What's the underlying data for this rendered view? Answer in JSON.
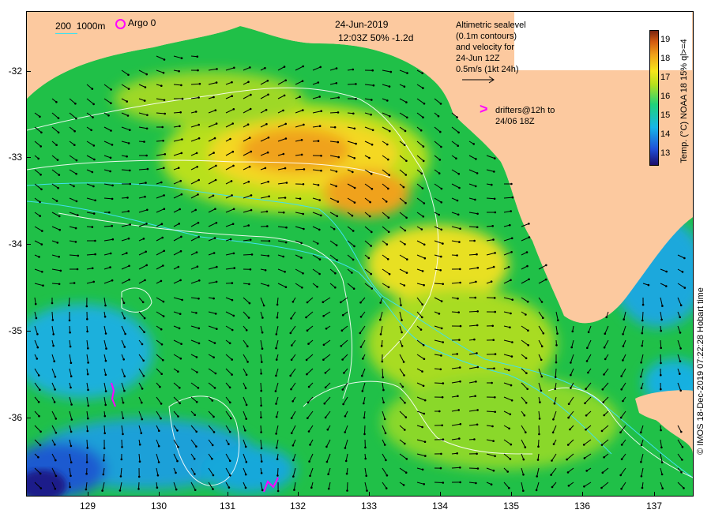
{
  "map": {
    "date": "24-Jun-2019",
    "time_line": "12:03Z  50% -1.2d",
    "scale_label": "200",
    "depth_label": "1000m",
    "argo_label": "Argo 0",
    "altimetry_lines": [
      "Altimetric sealevel",
      "(0.1m contours)",
      "and velocity for",
      "24-Jun 12Z",
      "0.5m/s (1kt 24h)"
    ],
    "drifter_symbol": ">",
    "drifter_lines": [
      "drifters@12h to",
      "24/06 18Z"
    ],
    "y_ticks": [
      "-32",
      "-33",
      "-34",
      "-35",
      "-36"
    ],
    "x_ticks": [
      "129",
      "130",
      "131",
      "132",
      "133",
      "134",
      "135",
      "136",
      "137"
    ],
    "colorbar_ticks": [
      "19",
      "18",
      "17",
      "16",
      "15",
      "14",
      "13"
    ],
    "colorbar_title": "Temp. (°C) NOAA 18 15% ql>=4",
    "credit": "© IMOS 18-Dec-2019 07:22:28 Hobart time",
    "colors": {
      "land": "#fcc99f",
      "ocean_green": "#1fc24a",
      "ocean_warm": "#f0a21a",
      "ocean_cool": "#16b6e8",
      "contour_cyan": "#40e0f0",
      "contour_white": "#ffffff",
      "drifter_magenta": "#ff00ff"
    }
  }
}
